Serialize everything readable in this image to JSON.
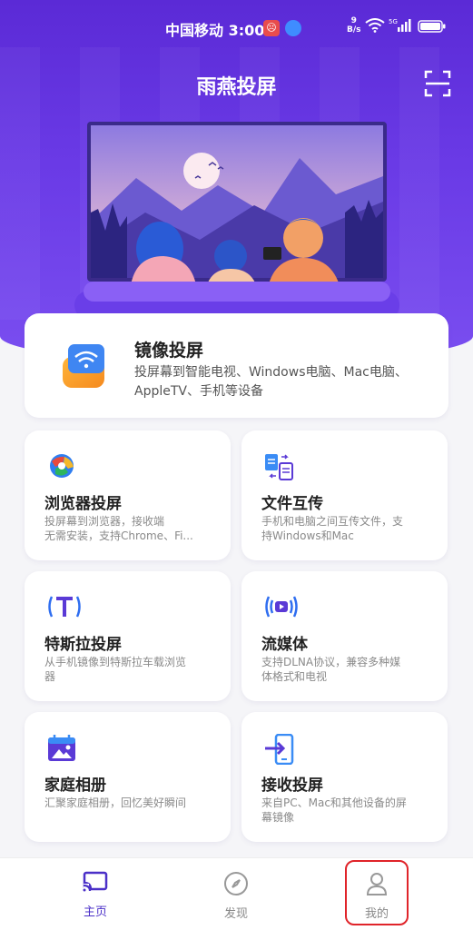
{
  "status_bar": {
    "carrier": "中国移动",
    "time": "3:00",
    "net_speed_value": "9",
    "net_speed_unit": "B/s",
    "network_type": "5G"
  },
  "header": {
    "title": "雨燕投屏",
    "scan_icon": "scan-icon"
  },
  "mirror_card": {
    "title": "镜像投屏",
    "description": "投屏幕到智能电视、Windows电脑、Mac电脑、AppleTV、手机等设备"
  },
  "features": [
    {
      "title": "浏览器投屏",
      "desc_line1": "投屏幕到浏览器，接收端",
      "desc_line2": "无需安装，支持Chrome、Fi...",
      "icon": "browser-icon"
    },
    {
      "title": "文件互传",
      "desc_line1": "手机和电脑之间互传文件，支",
      "desc_line2": "持Windows和Mac",
      "icon": "file-transfer-icon"
    },
    {
      "title": "特斯拉投屏",
      "desc_line1": "从手机镜像到特斯拉车载浏览",
      "desc_line2": "器",
      "icon": "tesla-icon"
    },
    {
      "title": "流媒体",
      "desc_line1": "支持DLNA协议，兼容多种媒",
      "desc_line2": "体格式和电视",
      "icon": "streaming-icon"
    },
    {
      "title": "家庭相册",
      "desc_line1": "汇聚家庭相册，回忆美好瞬间",
      "desc_line2": "",
      "icon": "album-icon"
    },
    {
      "title": "接收投屏",
      "desc_line1": "来自PC、Mac和其他设备的屏",
      "desc_line2": "幕镜像",
      "icon": "receive-icon"
    }
  ],
  "bottom_nav": [
    {
      "label": "主页",
      "icon": "cast-icon",
      "active": true
    },
    {
      "label": "发现",
      "icon": "compass-icon",
      "active": false
    },
    {
      "label": "我的",
      "icon": "user-icon",
      "active": false
    }
  ],
  "colors": {
    "brand_purple": "#5b2ad6",
    "accent_blue": "#4b30c8",
    "highlight_red": "#e0242a"
  }
}
